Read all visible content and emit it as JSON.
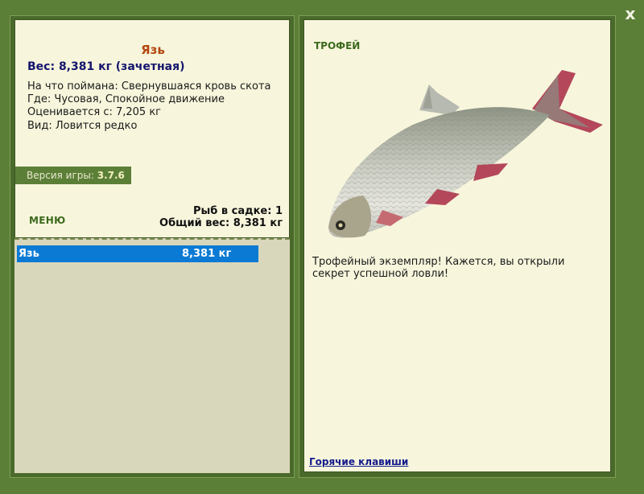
{
  "window": {
    "close_label": "x"
  },
  "catch": {
    "name": "Язь",
    "weight_line": "Вес: 8,381 кг (зачетная)",
    "bait_line": "На что поймана: Свернувшаяся кровь скота",
    "location_line": "Где: Чусовая, Спокойное движение",
    "valued_line": "Оценивается с: 7,205 кг",
    "rarity_line": "Вид: Ловится редко"
  },
  "version": {
    "label": "Версия игры:",
    "value": "3.7.6"
  },
  "menu_label": "МЕНЮ",
  "keepnet": {
    "count_line": "Рыб в садке: 1",
    "total_line": "Общий вес: 8,381 кг",
    "items": [
      {
        "name": "Язь",
        "weight": "8,381 кг"
      }
    ]
  },
  "trophy": {
    "title": "ТРОФЕЙ",
    "message": "Трофейный экземпляр! Кажется, вы открыли секрет успешной ловли!"
  },
  "hotkeys_label": "Горячие клавиши",
  "colors": {
    "background": "#5c7f37",
    "panel": "#f7f6dc",
    "fish_name": "#b3480f",
    "weight": "#15156e",
    "selection": "#0b7ad4",
    "link": "#141a8c"
  },
  "icons": {
    "close": "close-icon",
    "fish": "ide-fish-image"
  }
}
